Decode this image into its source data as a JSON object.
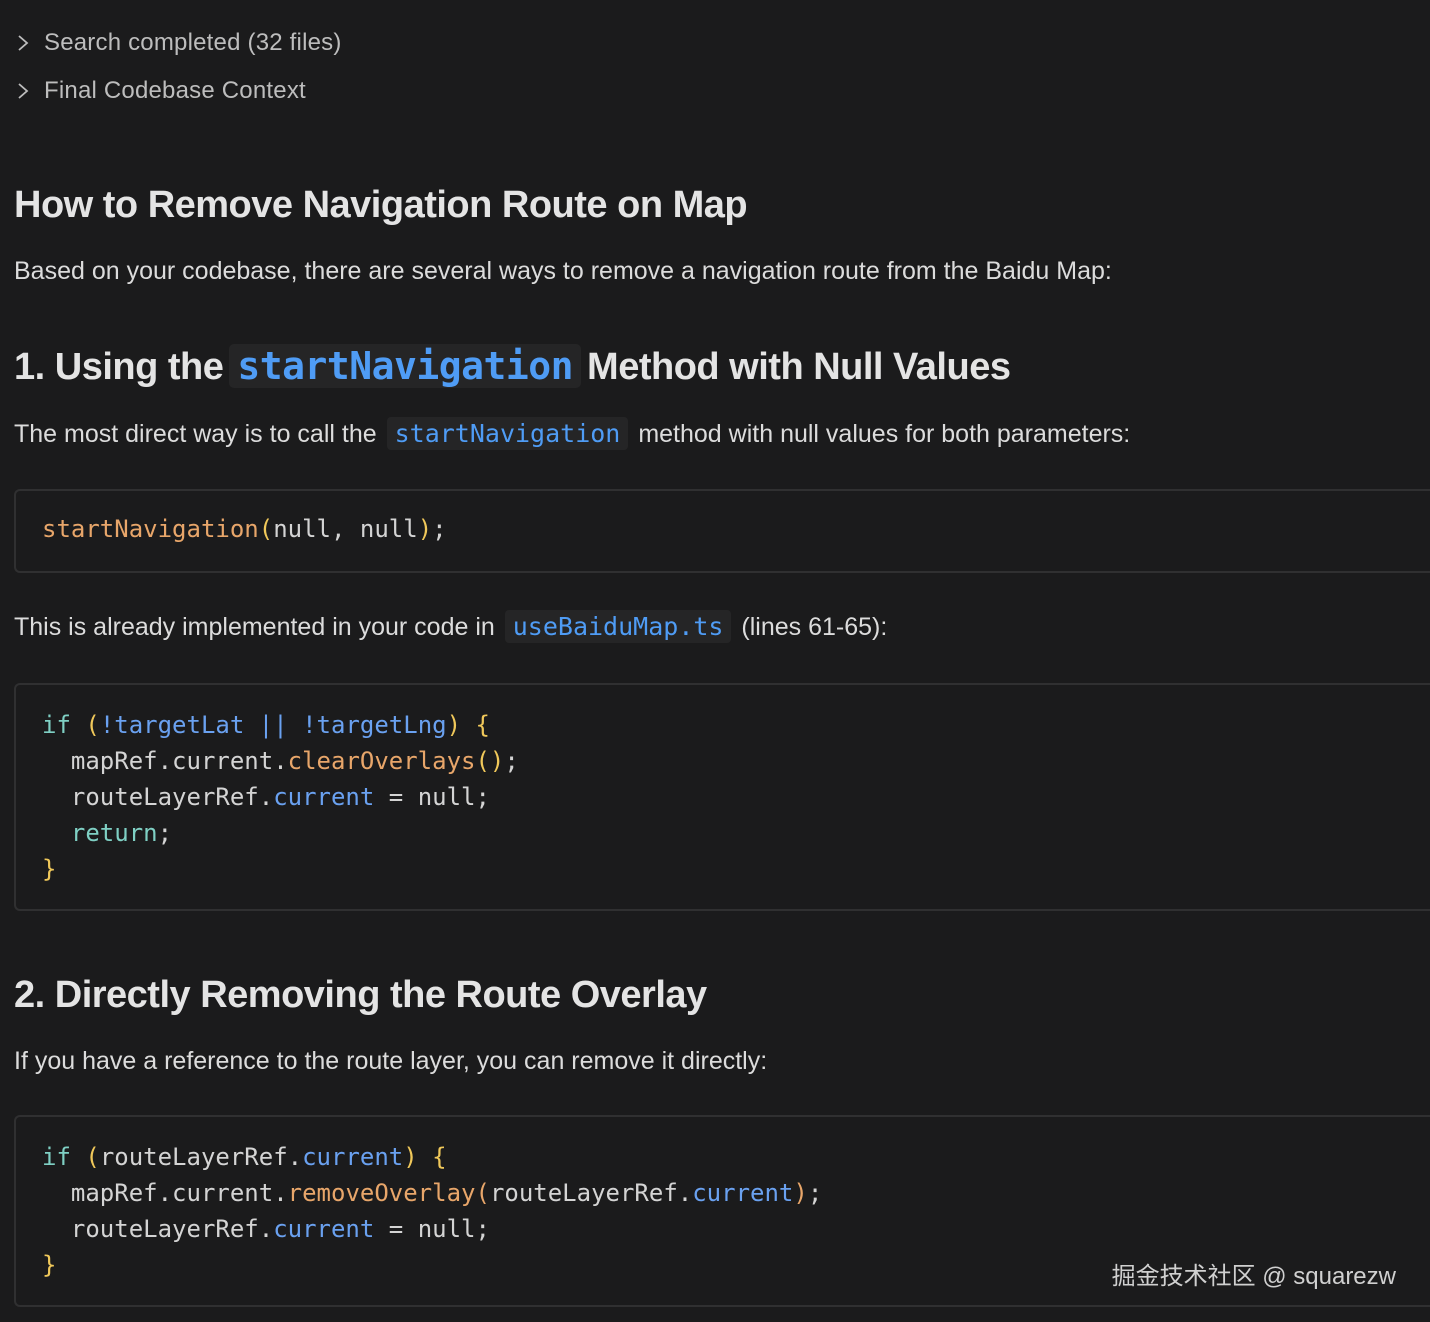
{
  "tool_sections": [
    {
      "label": "Search completed (32 files)",
      "icon": "chevron-right-icon"
    },
    {
      "label": "Final Codebase Context",
      "icon": "chevron-right-icon"
    }
  ],
  "title": "How to Remove Navigation Route on Map",
  "intro": "Based on your codebase, there are several ways to remove a navigation route from the Baidu Map:",
  "section1": {
    "heading_prefix": "1. Using the",
    "heading_code": "startNavigation",
    "heading_suffix": "Method with Null Values",
    "p1_before": "The most direct way is to call the",
    "p1_code": "startNavigation",
    "p1_after": "method with null values for both parameters:",
    "code1": {
      "fn": "startNavigation",
      "paren_open": "(",
      "args": "null, null",
      "paren_close": ")",
      "end": ";"
    },
    "p2_before": "This is already implemented in your code in",
    "p2_code": "useBaiduMap.ts",
    "p2_after": "(lines 61-65):",
    "code2": {
      "l1_kw": "if",
      "l1_open": " (",
      "l1_cond": "!targetLat || !targetLng",
      "l1_close": ")",
      "l1_brace": " {",
      "l2_obj": "  mapRef.current.",
      "l2_fn": "clearOverlays",
      "l2_parens": "()",
      "l2_end": ";",
      "l3_obj": "  routeLayerRef.",
      "l3_prop": "current",
      "l3_rest": " = null;",
      "l4_indent": "  ",
      "l4_kw": "return",
      "l4_end": ";",
      "l5_brace": "}"
    }
  },
  "section2": {
    "heading": "2. Directly Removing the Route Overlay",
    "p1": "If you have a reference to the route layer, you can remove it directly:",
    "code": {
      "l1_kw": "if",
      "l1_open": " (",
      "l1_obj": "routeLayerRef.",
      "l1_prop": "current",
      "l1_close": ")",
      "l1_brace": " {",
      "l2_obj": "  mapRef.current.",
      "l2_fn": "removeOverlay",
      "l2_paren_open": "(",
      "l2_arg_obj": "routeLayerRef.",
      "l2_arg_prop": "current",
      "l2_paren_close": ")",
      "l2_end": ";",
      "l3_obj": "  routeLayerRef.",
      "l3_prop": "current",
      "l3_rest": " = null;",
      "l4_brace": "}"
    }
  },
  "watermark": "掘金技术社区 @ squarezw",
  "colors": {
    "background": "#1b1b1c",
    "inline_code": "#4f9cf5",
    "keyword": "#7fd0c4",
    "function": "#e8a66a",
    "property": "#6aa1f0",
    "brace": "#f0c85a"
  }
}
